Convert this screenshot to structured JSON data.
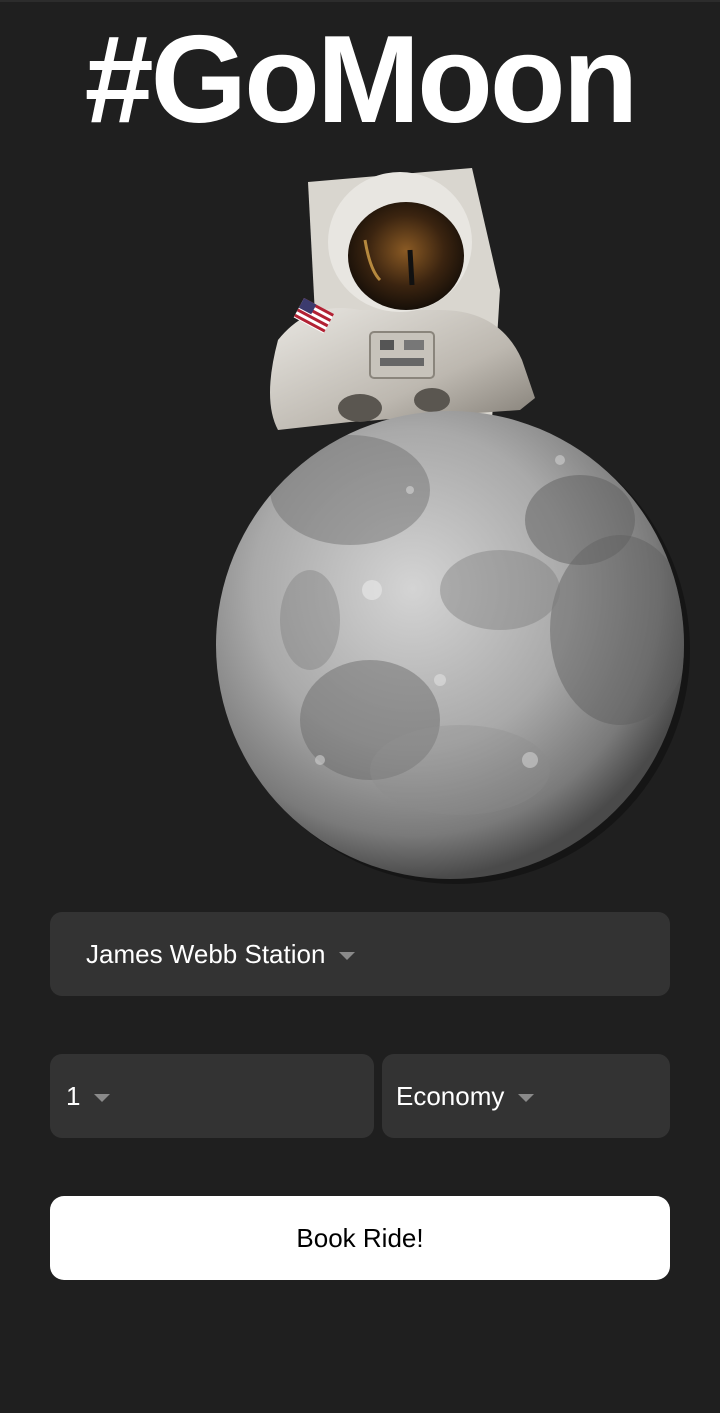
{
  "app": {
    "title": "#GoMoon"
  },
  "hero": {
    "image": "astronaut-on-moon-illustration"
  },
  "form": {
    "destination": {
      "selected": "James Webb Station"
    },
    "passengers": {
      "selected": "1"
    },
    "travel_class": {
      "selected": "Economy"
    },
    "book_button_label": "Book Ride!"
  },
  "colors": {
    "background": "#1f1f1f",
    "field_background": "#333333",
    "button_background": "#ffffff",
    "caret": "#8a8a8a"
  }
}
